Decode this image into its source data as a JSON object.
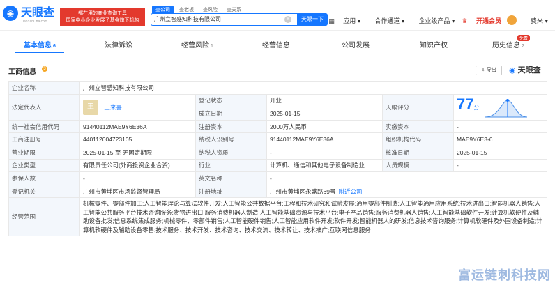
{
  "header": {
    "logo_text": "天眼查",
    "logo_sub": "TianYanCha.com",
    "promo_line1": "都在用的商业查询工具",
    "promo_line2": "国家中小企业发展子基金旗下机构",
    "search_tabs": [
      "查公司",
      "查老板",
      "查风险",
      "查关系"
    ],
    "search_value": "广州立智感知科技有限公司",
    "search_button": "天眼一下",
    "nav": [
      "应用",
      "合作通道",
      "企业级产品",
      "开通会员",
      "费米"
    ]
  },
  "tabs": [
    {
      "label": "基本信息",
      "count": "6"
    },
    {
      "label": "法律诉讼",
      "count": ""
    },
    {
      "label": "经营风险",
      "count": "1"
    },
    {
      "label": "经营信息",
      "count": ""
    },
    {
      "label": "公司发展",
      "count": ""
    },
    {
      "label": "知识产权",
      "count": ""
    },
    {
      "label": "历史信息",
      "count": "2"
    }
  ],
  "tab_badge": "免费",
  "section": {
    "title": "工商信息",
    "dot": "3",
    "export": "导出",
    "brand": "天眼查"
  },
  "info": {
    "company_name_label": "企业名称",
    "company_name": "广州立智感知科技有限公司",
    "legal_rep_label": "法定代表人",
    "legal_rep_avatar": "王",
    "legal_rep": "王来喜",
    "reg_status_label": "登记状态",
    "reg_status": "开业",
    "established_label": "成立日期",
    "established": "2025-01-15",
    "score_label": "天眼评分",
    "score": "77",
    "score_unit": "分",
    "credit_code_label": "统一社会信用代码",
    "credit_code": "91440112MAE9Y6E36A",
    "reg_capital_label": "注册资本",
    "reg_capital": "2000万人民币",
    "paid_capital_label": "实缴资本",
    "paid_capital": "-",
    "reg_no_label": "工商注册号",
    "reg_no": "440112004723105",
    "taxpayer_id_label": "纳税人识别号",
    "taxpayer_id": "91440112MAE9Y6E36A",
    "org_code_label": "组织机构代码",
    "org_code": "MAE9Y6E3-6",
    "term_label": "营业期限",
    "term": "2025-01-15 至 无固定期限",
    "taxpayer_qual_label": "纳税人资质",
    "taxpayer_qual": "-",
    "approval_date_label": "核准日期",
    "approval_date": "2025-01-15",
    "type_label": "企业类型",
    "type": "有限责任公司(外商投资企业合资)",
    "industry_label": "行业",
    "industry": "计算机、通信和其他电子设备制造业",
    "staff_label": "人员规模",
    "staff": "-",
    "insured_label": "参保人数",
    "insured": "-",
    "en_name_label": "英文名称",
    "en_name": "-",
    "authority_label": "登记机关",
    "authority": "广州市黄埔区市场监督管理局",
    "address_label": "注册地址",
    "address": "广州市黄埔区永盛路69号",
    "nearby": "附近公司",
    "scope_label": "经营范围",
    "scope": "机械零件、零部件加工;人工智能理论与算法软件开发;人工智能公共数据平台;工程和技术研究和试验发展;通用零部件制造;人工智能通用应用系统;技术进出口;智能机器人销售;人工智能公共服务平台技术咨询服务;货物进出口;服务消费机器人制造;人工智能基础资源与技术平台;电子产品销售;服务消费机器人销售;人工智能基础软件开发;计算机软硬件及辅助设备批发;信息系统集成服务;机械零件、零部件销售;人工智能硬件销售;人工智能应用软件开发;软件开发;智能机器人的研发;信息技术咨询服务;计算机软硬件及外围设备制造;计算机软硬件及辅助设备零售;技术服务、技术开发、技术咨询、技术交流、技术转让、技术推广;互联网信息服务"
  },
  "watermark": "富运链刺科技网"
}
